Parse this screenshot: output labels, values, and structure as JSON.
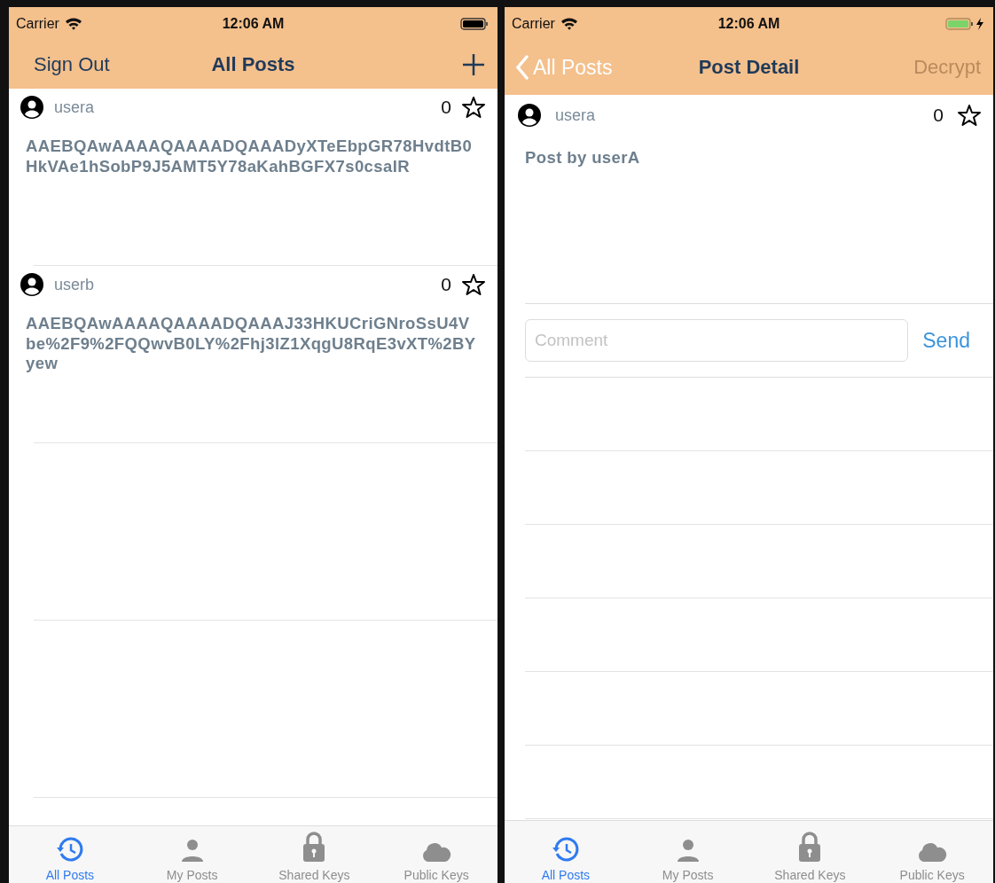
{
  "screens": [
    {
      "kind": "list",
      "status_bar": {
        "carrier": "Carrier",
        "time": "12:06 AM",
        "charging": false
      },
      "nav_bar": {
        "left": {
          "kind": "text",
          "label": "Sign Out",
          "disabled": false
        },
        "title": "All Posts",
        "right": {
          "kind": "add"
        }
      },
      "posts": [
        {
          "user": "usera",
          "star_count": "0",
          "starred": false,
          "body": "AAEBQAwAAAAQAAAADQAAADyXTeEbpGR78HvdtB0HkVAe1hSobP9J5AMT5Y78aKahBGFX7s0csaIR"
        },
        {
          "user": "userb",
          "star_count": "0",
          "starred": false,
          "body": "AAEBQAwAAAAQAAAADQAAAJ33HKUCriGNroSsU4Vbe%2F9%2FQQwvB0LY%2Fhj3lZ1XqgU8RqE3vXT%2BYyew"
        }
      ],
      "tab_bar": [
        {
          "label": "All Posts",
          "selected": true
        },
        {
          "label": "My Posts",
          "selected": false
        },
        {
          "label": "Shared Keys",
          "selected": false
        },
        {
          "label": "Public Keys",
          "selected": false
        }
      ]
    },
    {
      "kind": "detail",
      "status_bar": {
        "carrier": "Carrier",
        "time": "12:06 AM",
        "charging": true
      },
      "nav_bar": {
        "left": {
          "kind": "back",
          "label": "All Posts"
        },
        "title": "Post Detail",
        "right": {
          "kind": "text",
          "label": "Decrypt",
          "disabled": true
        }
      },
      "posts": [
        {
          "user": "usera",
          "star_count": "0",
          "starred": false,
          "body": "Post by userA"
        }
      ],
      "comment": {
        "placeholder": "Comment",
        "button": "Send"
      },
      "tab_bar": [
        {
          "label": "All Posts",
          "selected": true
        },
        {
          "label": "My Posts",
          "selected": false
        },
        {
          "label": "Shared Keys",
          "selected": false
        },
        {
          "label": "Public Keys",
          "selected": false
        }
      ]
    }
  ]
}
